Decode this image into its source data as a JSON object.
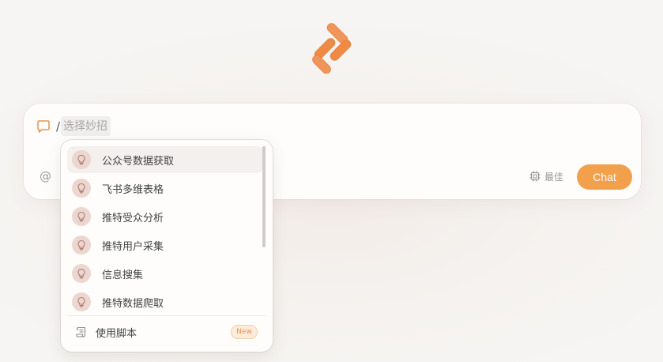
{
  "composer": {
    "slash": "/",
    "trick_placeholder": "选择妙招",
    "mention_symbol": "@",
    "model_label": "最佳",
    "send_label": "Chat"
  },
  "tricks_menu": {
    "items": [
      {
        "label": "公众号数据获取",
        "icon": "lightbulb-icon",
        "active": true
      },
      {
        "label": "飞书多维表格",
        "icon": "lightbulb-icon"
      },
      {
        "label": "推特受众分析",
        "icon": "lightbulb-icon"
      },
      {
        "label": "推特用户采集",
        "icon": "lightbulb-icon"
      },
      {
        "label": "信息搜集",
        "icon": "lightbulb-icon"
      },
      {
        "label": "推特数据爬取",
        "icon": "lightbulb-icon"
      }
    ],
    "script_label": "使用脚本",
    "script_icon": "scroll-icon",
    "new_badge": "New"
  },
  "icons": {
    "logo": "brand-logo",
    "chat": "chat-bubble-icon",
    "model": "chip-icon"
  },
  "colors": {
    "accent": "#f2a04c",
    "logo_orange": "#ef8a45",
    "bulb_bg": "#ecd6d0",
    "badge_text": "#e9934b"
  }
}
